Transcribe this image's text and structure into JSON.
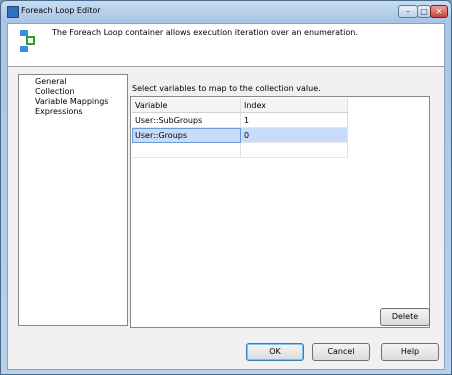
{
  "window": {
    "title": "Foreach Loop Editor",
    "controls": {
      "minimize": "–",
      "maximize": "□",
      "close": "✕"
    }
  },
  "header": {
    "icon": "foreach-loop-icon",
    "description": "The Foreach Loop container allows execution iteration over an enumeration."
  },
  "nav": {
    "items": [
      {
        "label": "General"
      },
      {
        "label": "Collection"
      },
      {
        "label": "Variable Mappings",
        "selected": true
      },
      {
        "label": "Expressions"
      }
    ]
  },
  "mappings": {
    "instruction": "Select variables to map to the collection value.",
    "columns": [
      "Variable",
      "Index"
    ],
    "rows": [
      {
        "variable": "User::SubGroups",
        "index": "1"
      },
      {
        "variable": "User::Groups",
        "index": "0",
        "selected": true
      },
      {
        "variable": "",
        "index": ""
      }
    ]
  },
  "buttons": {
    "delete": "Delete",
    "ok": "OK",
    "cancel": "Cancel",
    "help": "Help"
  },
  "colors": {
    "selection": "#c6dcf8",
    "titlebar": "#b8d0ea",
    "close": "#c9463b"
  }
}
